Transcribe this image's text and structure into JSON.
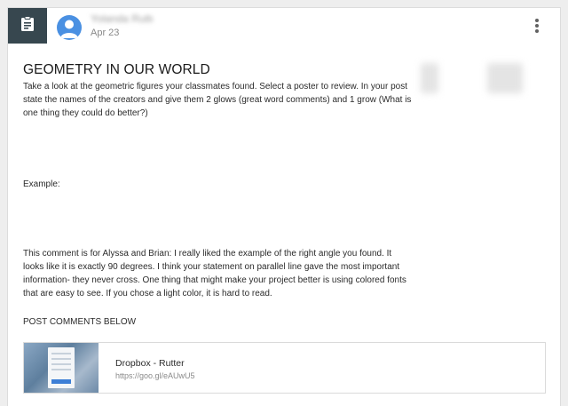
{
  "post": {
    "author": "Yolanda Rutter",
    "date": "Apr 23",
    "title": "GEOMETRY IN OUR WORLD",
    "instructions": "Take a look at the geometric figures your classmates found. Select a poster to review. In your post state the names of the creators and give them 2 glows (great word comments) and 1 grow (What is one thing they could do better?)",
    "example_label": "Example:",
    "example_comment": "This comment is for Alyssa and Brian: I really liked the example of the right angle you found. It looks like it is exactly 90 degrees. I think your statement on parallel line gave the most important information- they never cross. One thing that might make your project better is using colored fonts that are easy to see. If you chose a light color, it is hard to read.",
    "post_comments_label": "POST COMMENTS BELOW"
  },
  "attachment": {
    "title": "Dropbox - Rutter",
    "url": "https://goo.gl/eAUwU5"
  },
  "icons": {
    "type": "assignment-icon",
    "more": "more-vert-icon",
    "avatar": "person-avatar-icon"
  },
  "colors": {
    "type_tile": "#37474f",
    "avatar": "#4a90e2"
  }
}
